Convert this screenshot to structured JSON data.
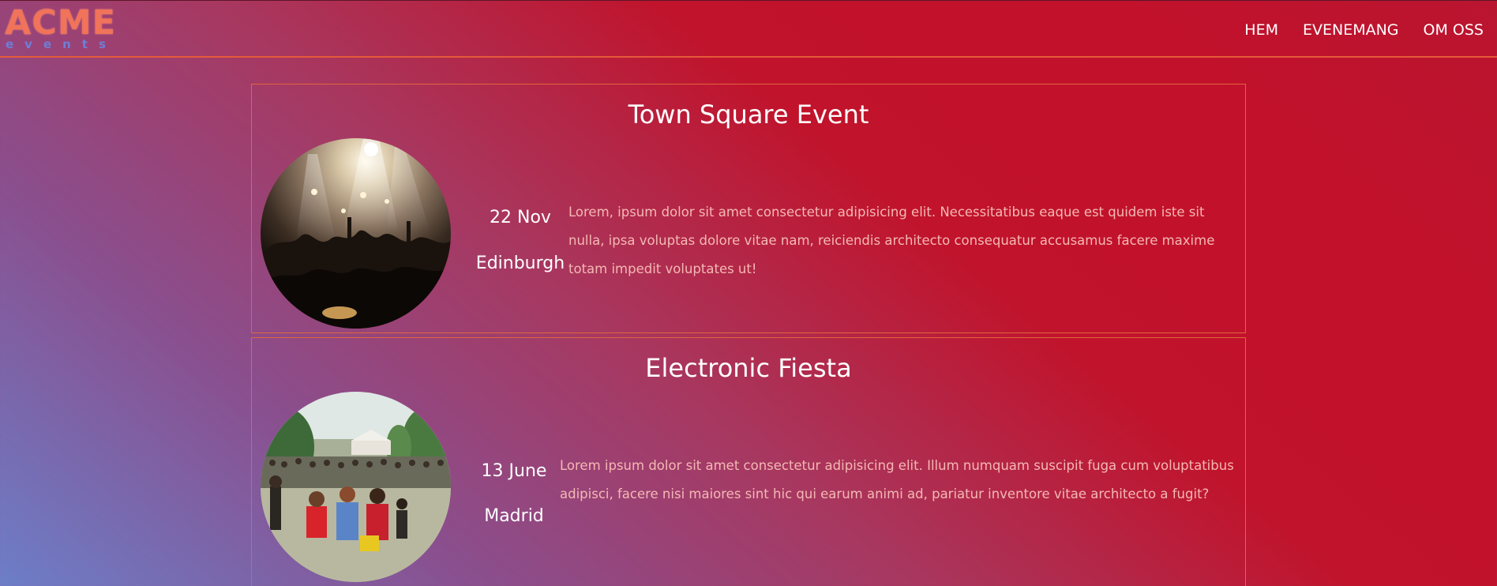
{
  "header": {
    "logo_main": "ACME",
    "logo_sub": "events",
    "nav": [
      {
        "label": "HEM"
      },
      {
        "label": "EVENEMANG"
      },
      {
        "label": "OM OSS"
      }
    ]
  },
  "events": [
    {
      "title": "Town Square Event",
      "date": "22 Nov",
      "city": "Edinburgh",
      "description": "Lorem, ipsum dolor sit amet consectetur adipisicing elit. Necessitatibus eaque est quidem iste sit nulla, ipsa voluptas dolore vitae nam, reiciendis architecto consequatur accusamus facere maxime totam impedit voluptates ut!",
      "image": "concert-crowd-photo"
    },
    {
      "title": "Electronic Fiesta",
      "date": "13 June",
      "city": "Madrid",
      "description": "Lorem ipsum dolor sit amet consectetur adipisicing elit. Illum numquam suscipit fuga cum voluptatibus adipisci, facere nisi maiores sint hic qui earum animi ad, pariatur inventore vitae architecto a fugit?",
      "image": "outdoor-festival-photo"
    }
  ],
  "colors": {
    "accent_border": "#e0663e",
    "logo": "#f0735a",
    "logo_sub": "#6f7ed6",
    "description_text": "#f4b8b4",
    "gradient_red": "#c2112b",
    "gradient_blue": "#6c7ec8"
  }
}
